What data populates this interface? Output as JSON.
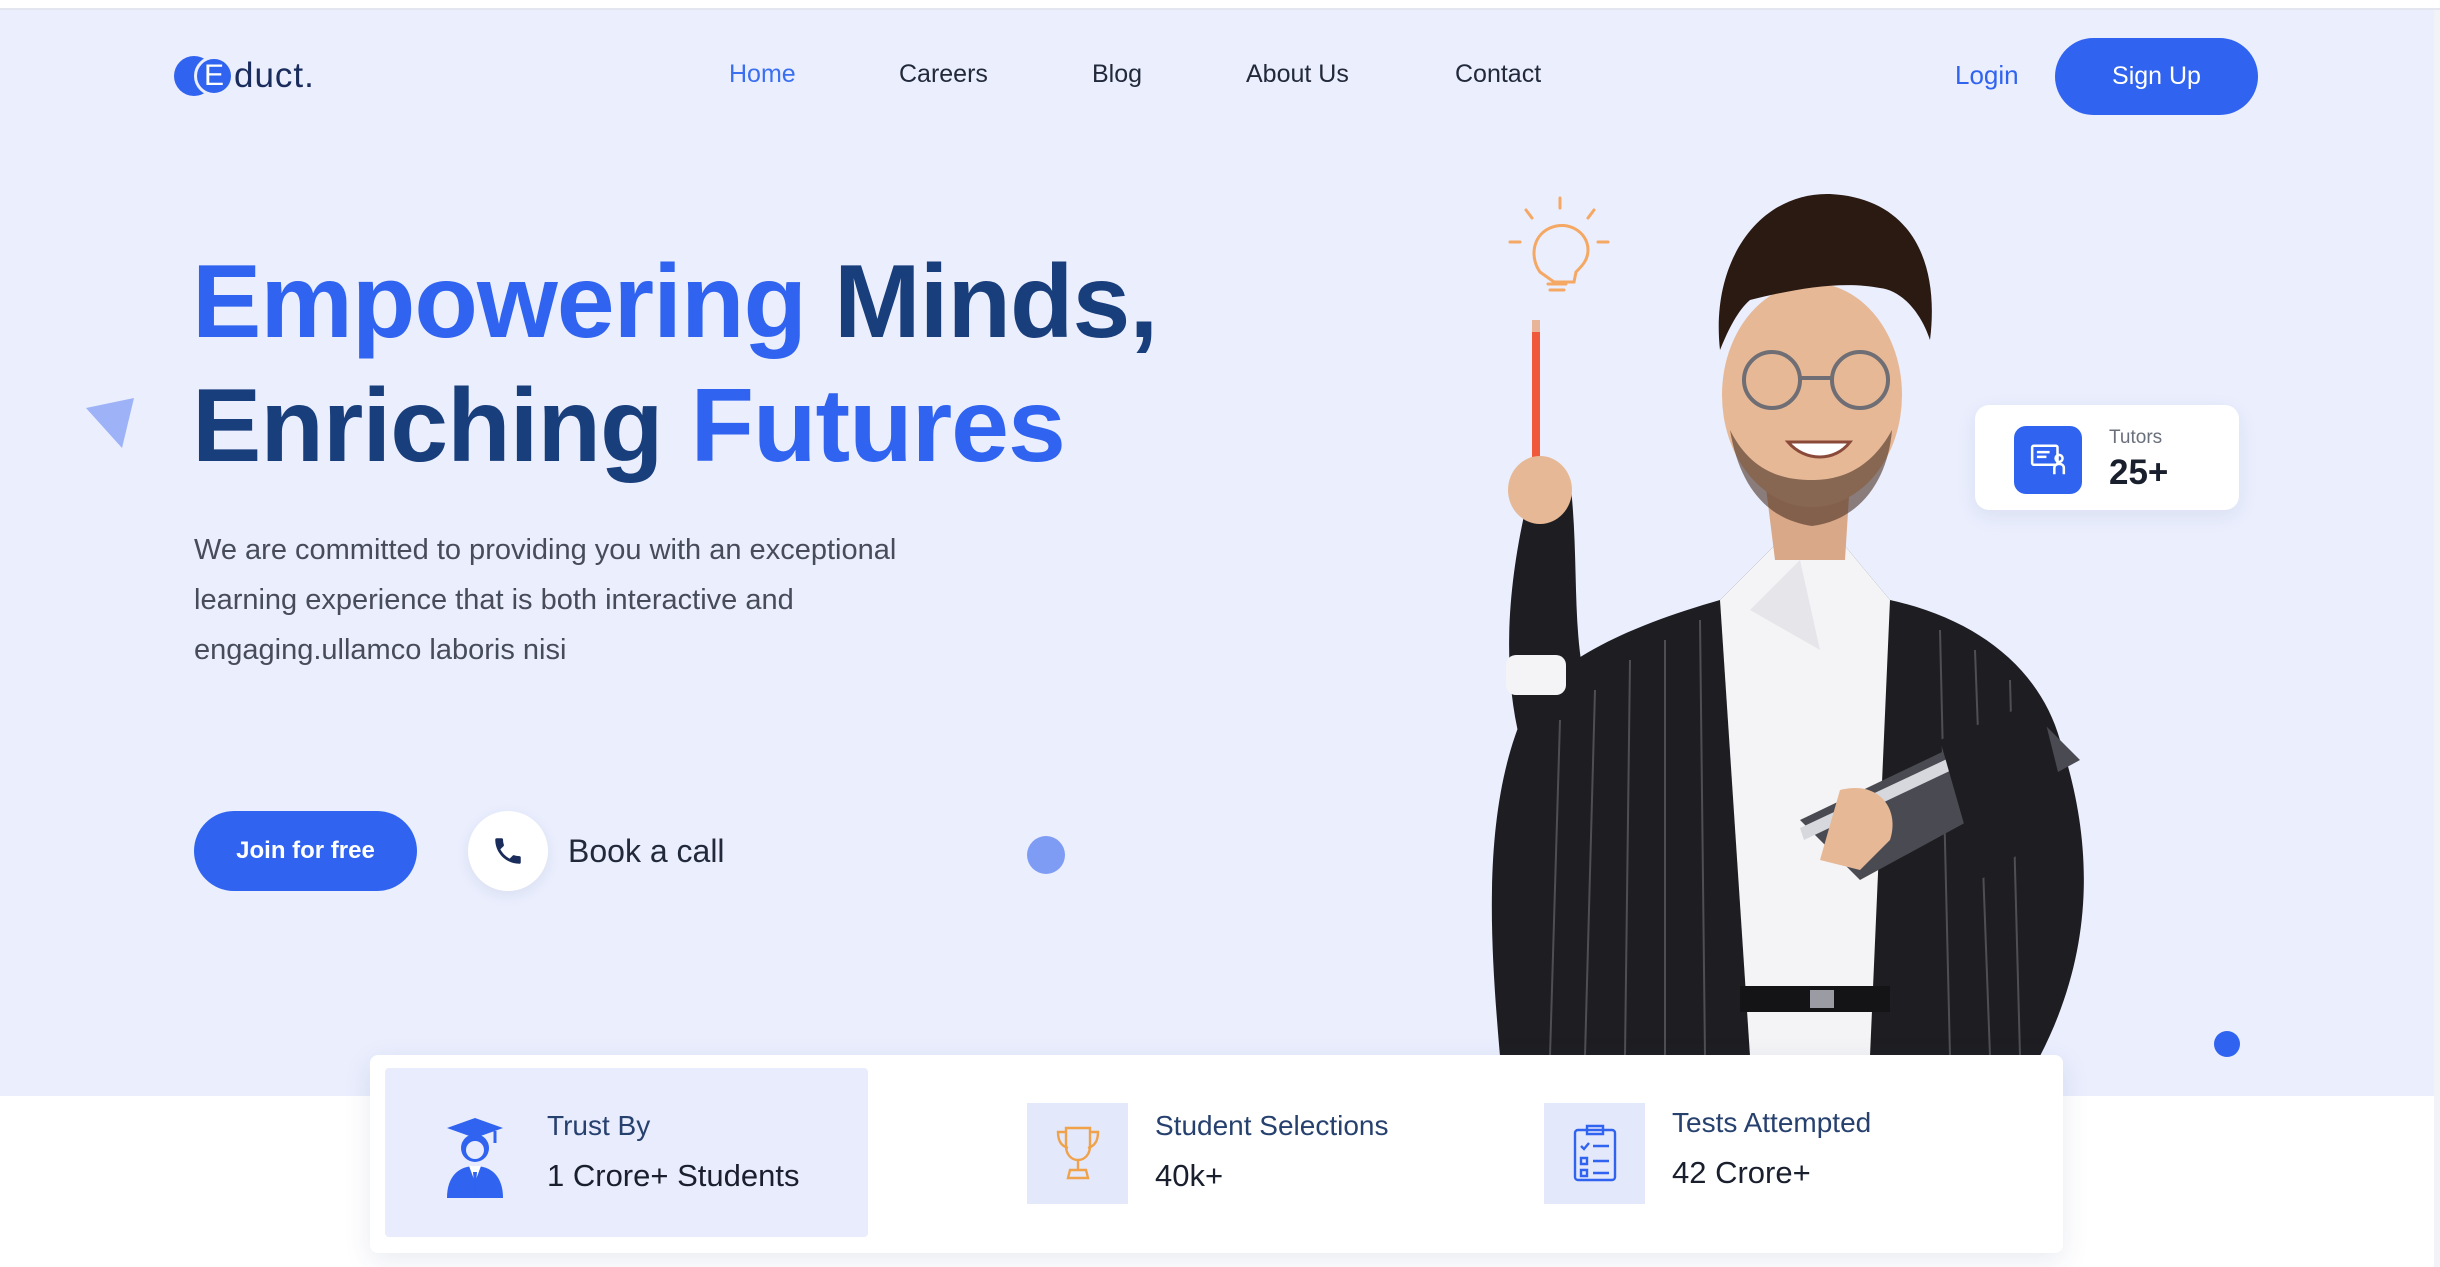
{
  "brand": {
    "logo_letter": "E",
    "logo_text": "duct."
  },
  "nav": {
    "items": [
      "Home",
      "Careers",
      "Blog",
      "About Us",
      "Contact"
    ],
    "active": "Home"
  },
  "auth": {
    "login": "Login",
    "signup": "Sign Up"
  },
  "hero": {
    "line1_part1": "Empowering",
    "line1_part2": " Minds,",
    "line2_part1": "Enriching ",
    "line2_part2": "Futures",
    "description": "We are committed to providing you with an exceptional learning experience that is both interactive and engaging.ullamco laboris nisi",
    "join_button": "Join for free",
    "book_call": "Book a call"
  },
  "tutors_card": {
    "label": "Tutors",
    "value": "25+"
  },
  "stats": [
    {
      "label": "Trust By",
      "value": "1 Crore+ Students",
      "icon": "graduate-icon"
    },
    {
      "label": "Student Selections",
      "value": "40k+",
      "icon": "trophy-icon"
    },
    {
      "label": "Tests Attempted",
      "value": "42 Crore+",
      "icon": "checklist-icon"
    }
  ],
  "colors": {
    "accent": "#2f63f0",
    "heading_dark": "#193e7c",
    "hero_bg": "#eaeefd",
    "trophy": "#f0a24a"
  }
}
